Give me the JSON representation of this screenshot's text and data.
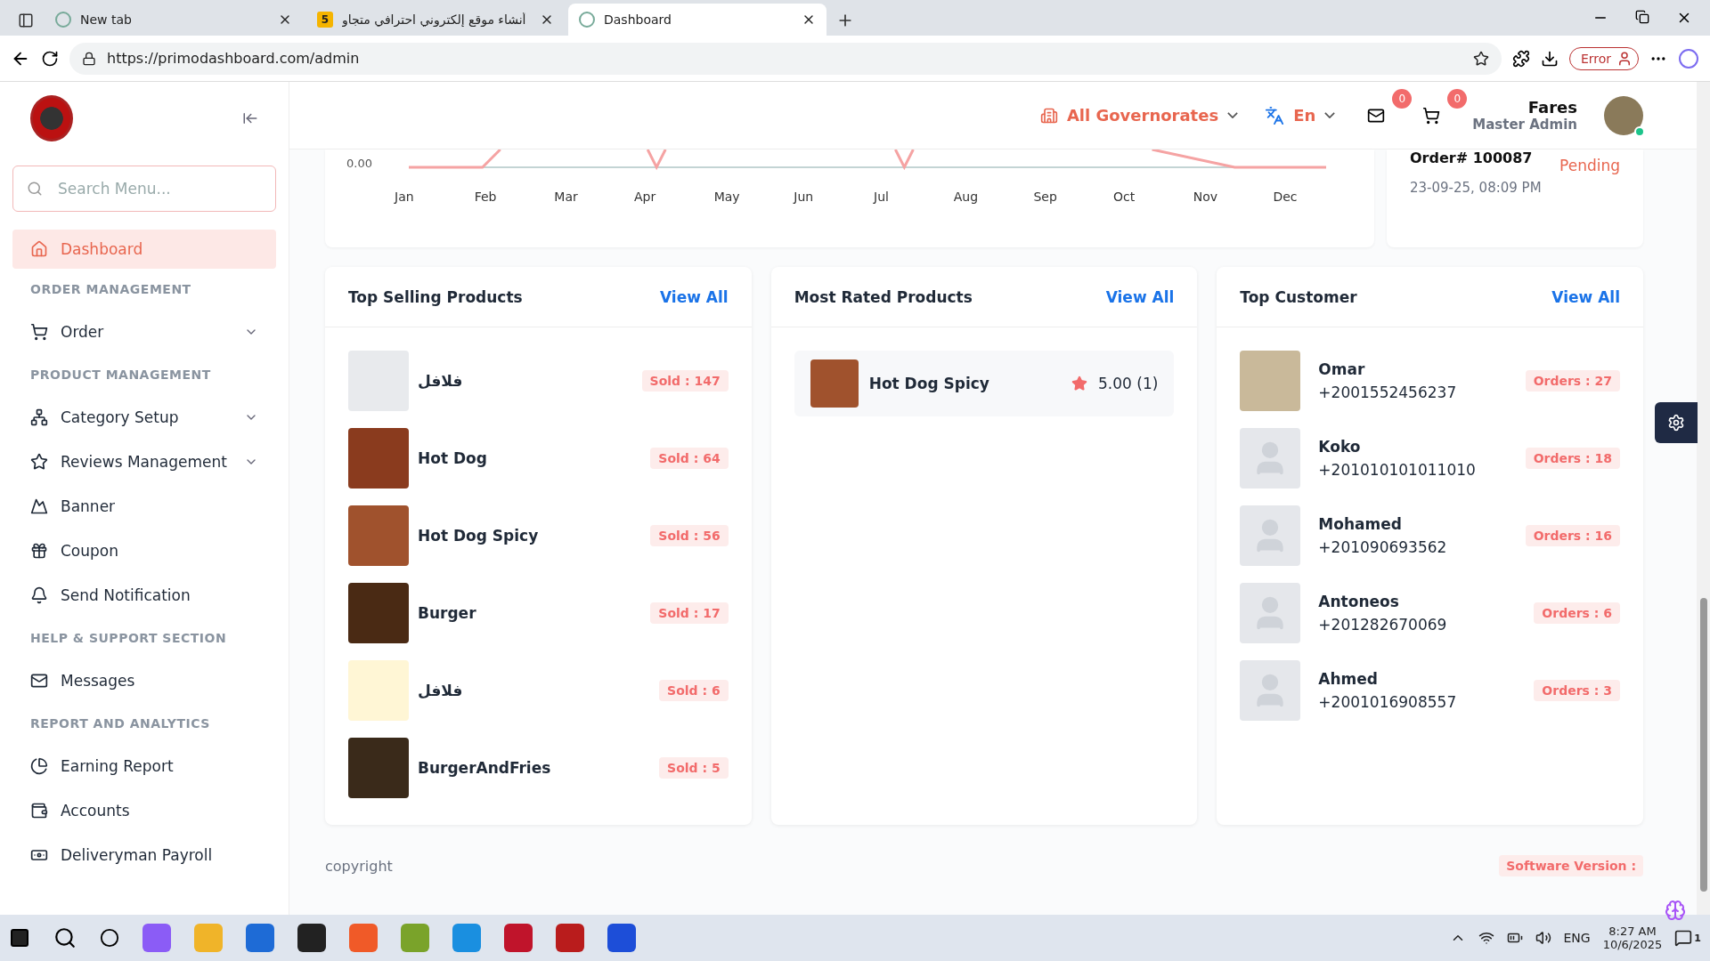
{
  "browser": {
    "tabs": [
      {
        "title": "New tab",
        "selected": false
      },
      {
        "title": "أنشاء موقع إلكتروني احترافي متجاو",
        "badge": "5",
        "selected": false
      },
      {
        "title": "Dashboard",
        "selected": true
      }
    ],
    "url": "https://primodashboard.com/admin",
    "profile_button": "Error"
  },
  "sidebar": {
    "search_placeholder": "Search Menu...",
    "sections": [
      {
        "items": [
          {
            "label": "Dashboard",
            "selected": true,
            "has_submenu": false
          }
        ]
      },
      {
        "heading": "ORDER MANAGEMENT",
        "items": [
          {
            "label": "Order",
            "selected": false,
            "has_submenu": true
          }
        ]
      },
      {
        "heading": "PRODUCT MANAGEMENT",
        "items": [
          {
            "label": "Category Setup",
            "selected": false,
            "has_submenu": true
          },
          {
            "label": "Reviews Management",
            "selected": false,
            "has_submenu": true
          },
          {
            "label": "Banner",
            "selected": false,
            "has_submenu": false
          },
          {
            "label": "Coupon",
            "selected": false,
            "has_submenu": false
          },
          {
            "label": "Send Notification",
            "selected": false,
            "has_submenu": false
          }
        ]
      },
      {
        "heading": "HELP & SUPPORT SECTION",
        "items": [
          {
            "label": "Messages",
            "selected": false,
            "has_submenu": false
          }
        ]
      },
      {
        "heading": "REPORT AND ANALYTICS",
        "items": [
          {
            "label": "Earning Report",
            "selected": false,
            "has_submenu": false
          },
          {
            "label": "Accounts",
            "selected": false,
            "has_submenu": false
          },
          {
            "label": "Deliveryman Payroll",
            "selected": false,
            "has_submenu": false
          }
        ]
      }
    ]
  },
  "header": {
    "region": "All Governorates",
    "language": "En",
    "messages_count": "0",
    "cart_count": "0",
    "user_name": "Fares",
    "user_role": "Master Admin",
    "online": true
  },
  "sales_chart": {
    "y_tick": "0.00",
    "months": [
      "Jan",
      "Feb",
      "Mar",
      "Apr",
      "May",
      "Jun",
      "Jul",
      "Aug",
      "Sep",
      "Oct",
      "Nov",
      "Dec"
    ]
  },
  "latest_order": {
    "number": "Order# 100087",
    "date": "23-09-25, 08:09 PM",
    "status": "Pending"
  },
  "top_selling": {
    "title": "Top Selling Products",
    "view_all": "View All",
    "products": [
      {
        "name": "فلافل",
        "sold": "Sold : 147"
      },
      {
        "name": "Hot Dog",
        "sold": "Sold : 64"
      },
      {
        "name": "Hot Dog Spicy",
        "sold": "Sold : 56"
      },
      {
        "name": "Burger",
        "sold": "Sold : 17"
      },
      {
        "name": "فلافل",
        "sold": "Sold : 6"
      },
      {
        "name": "BurgerAndFries",
        "sold": "Sold : 5"
      }
    ]
  },
  "most_rated": {
    "title": "Most Rated Products",
    "view_all": "View All",
    "products": [
      {
        "name": "Hot Dog Spicy",
        "rating": "5.00 (1)"
      }
    ]
  },
  "top_customer": {
    "title": "Top Customer",
    "view_all": "View All",
    "customers": [
      {
        "name": "Omar",
        "phone": "+2001552456237",
        "orders": "Orders : 27",
        "has_photo": true
      },
      {
        "name": "Koko",
        "phone": "+201010101011010",
        "orders": "Orders : 18",
        "has_photo": false
      },
      {
        "name": "Mohamed",
        "phone": "+201090693562",
        "orders": "Orders : 16",
        "has_photo": false
      },
      {
        "name": "Antoneos",
        "phone": "+201282670069",
        "orders": "Orders : 6",
        "has_photo": false
      },
      {
        "name": "Ahmed",
        "phone": "+2001016908557",
        "orders": "Orders : 3",
        "has_photo": false
      }
    ]
  },
  "footer": {
    "copyright": "copyright",
    "version": "Software Version :"
  },
  "taskbar": {
    "language": "ENG",
    "time": "8:27 AM",
    "date": "10/6/2025",
    "notifications": "1"
  }
}
